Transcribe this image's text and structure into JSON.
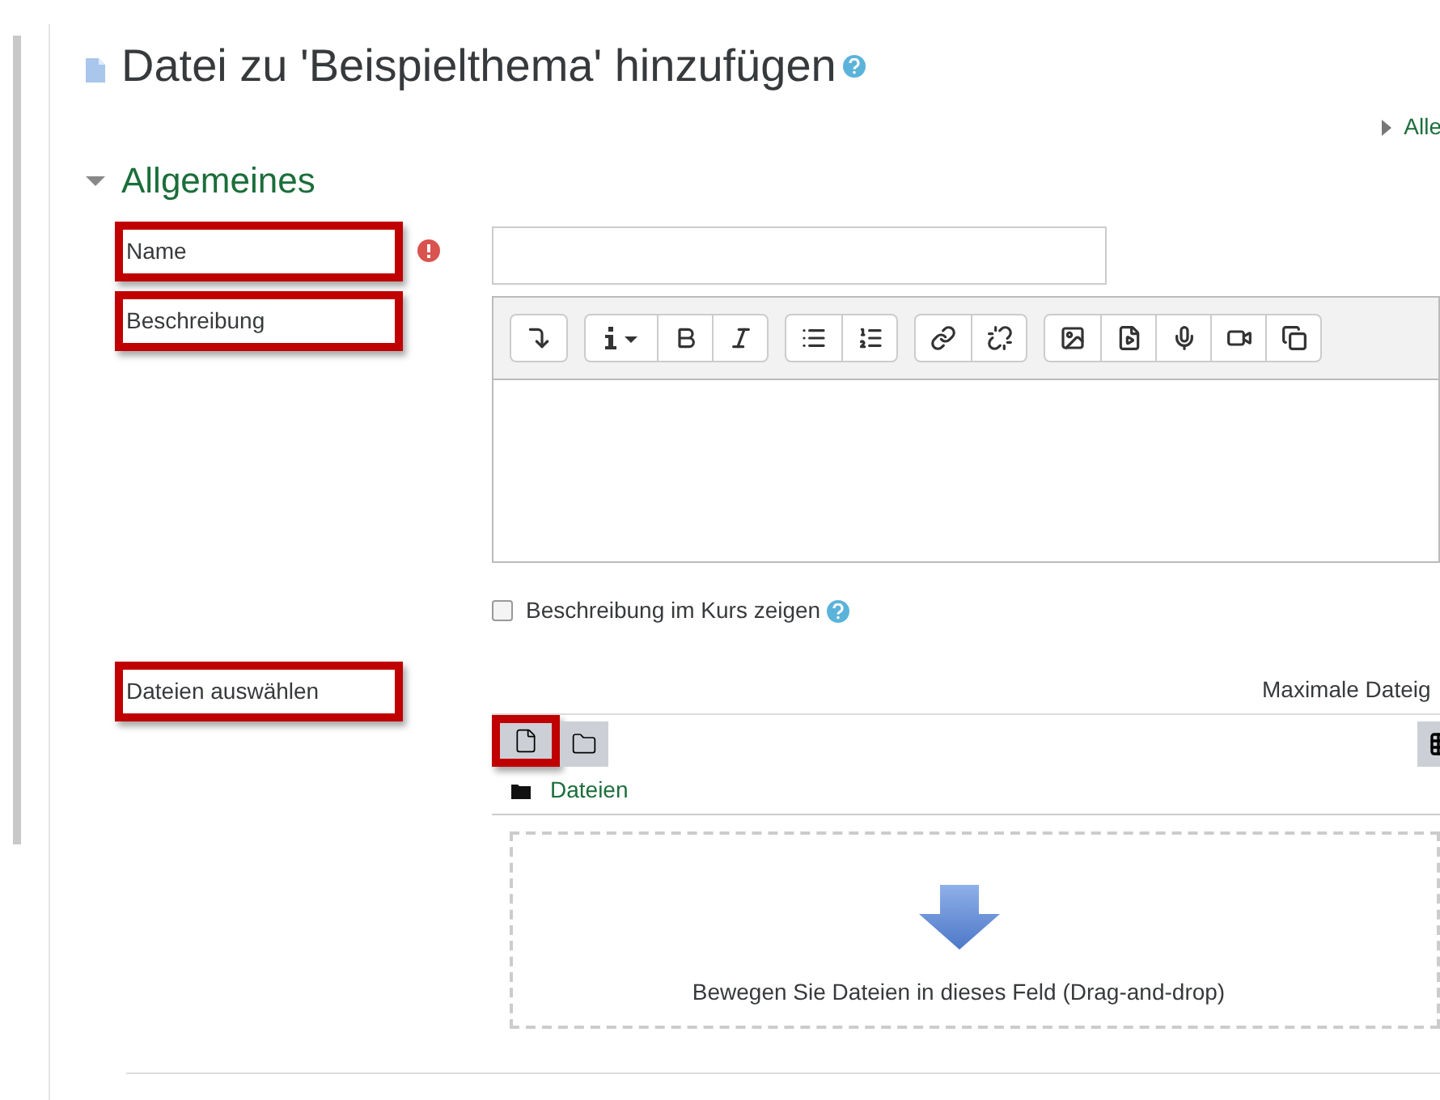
{
  "title": "Datei zu 'Beispielthema' hinzufügen",
  "expand_all": "Alle",
  "section": {
    "title": "Allgemeines",
    "expanded": true
  },
  "fields": [
    {
      "kind": "text",
      "label": "Name",
      "highlighted": true,
      "required": true
    },
    {
      "kind": "editor",
      "label": "Beschreibung",
      "highlighted": true
    },
    {
      "kind": "checkbox",
      "label": "Beschreibung im Kurs zeigen",
      "checked": false
    },
    {
      "kind": "filepicker",
      "label": "Dateien auswählen",
      "highlighted": true,
      "max_size": "Maximale Dateig",
      "add_file_highlighted": true,
      "folder": "Dateien",
      "drop_hint": "Bewegen Sie Dateien in dieses Feld (Drag-and-drop)"
    }
  ]
}
